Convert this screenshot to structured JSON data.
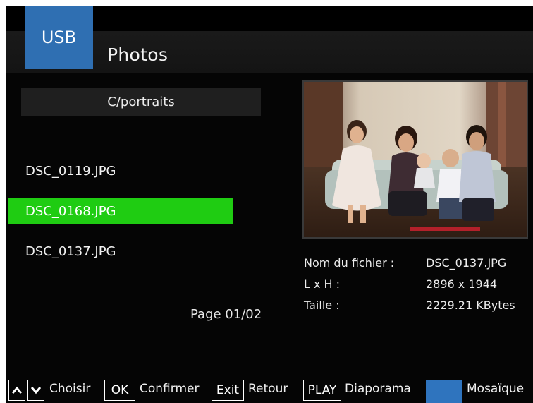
{
  "header": {
    "source_badge": "USB",
    "title": "Photos"
  },
  "browser": {
    "current_folder": "C/portraits",
    "files": [
      {
        "name": "DSC_0119.JPG",
        "selected": false
      },
      {
        "name": "DSC_0168.JPG",
        "selected": true
      },
      {
        "name": "DSC_0137.JPG",
        "selected": false
      }
    ],
    "page_indicator": "Page 01/02"
  },
  "preview": {
    "image_content": "family-portrait-photo"
  },
  "details": {
    "filename_label": "Nom du fichier :",
    "filename_value": "DSC_0137.JPG",
    "dimensions_label": "L x H :",
    "dimensions_value": "2896 x 1944",
    "size_label": "Taille :",
    "size_value": "2229.21 KBytes"
  },
  "help_bar": {
    "up_key": "up-arrow-icon",
    "down_key": "down-arrow-icon",
    "choose_label": "Choisir",
    "ok_key": "OK",
    "confirm_label": "Confirmer",
    "exit_key": "Exit",
    "back_label": "Retour",
    "play_key": "PLAY",
    "slideshow_label": "Diaporama",
    "blue_key_color": "#2f74be",
    "mosaic_label": "Mosaïque"
  },
  "colors": {
    "selection": "#1fcc12",
    "accent": "#2f6fb2",
    "background": "#050505"
  }
}
